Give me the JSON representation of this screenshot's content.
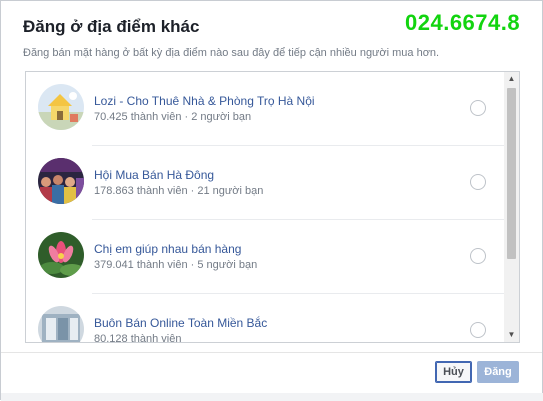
{
  "dialog": {
    "title": "Đăng ở địa điểm khác",
    "subtitle": "Đăng bán mặt hàng ở bất kỳ địa điểm nào sau đây để tiếp cận nhiều người mua hơn."
  },
  "watermark": {
    "text": "024.6674.8",
    "color": "#12d40f"
  },
  "groups": [
    {
      "name": "Lozi - Cho Thuê Nhà & Phòng Trọ Hà Nội",
      "meta": "70.425 thành viên · 2 người bạn",
      "avatar": "lozi-house-avatar"
    },
    {
      "name": "Hội Mua Bán Hà Đông",
      "meta": "178.863 thành viên · 21 người bạn",
      "avatar": "market-crowd-avatar"
    },
    {
      "name": "Chị em giúp nhau bán hàng",
      "meta": "379.041 thành viên · 5 người bạn",
      "avatar": "lotus-flower-avatar"
    },
    {
      "name": "Buôn Bán Online Toàn Miền Bắc",
      "meta": "80.128 thành viên",
      "avatar": "storefront-avatar"
    }
  ],
  "buttons": {
    "cancel": "Hủy",
    "post": "Đăng"
  },
  "colors": {
    "link": "#365899",
    "accent": "#4267b2",
    "disabled_button": "#9cb4d8"
  }
}
